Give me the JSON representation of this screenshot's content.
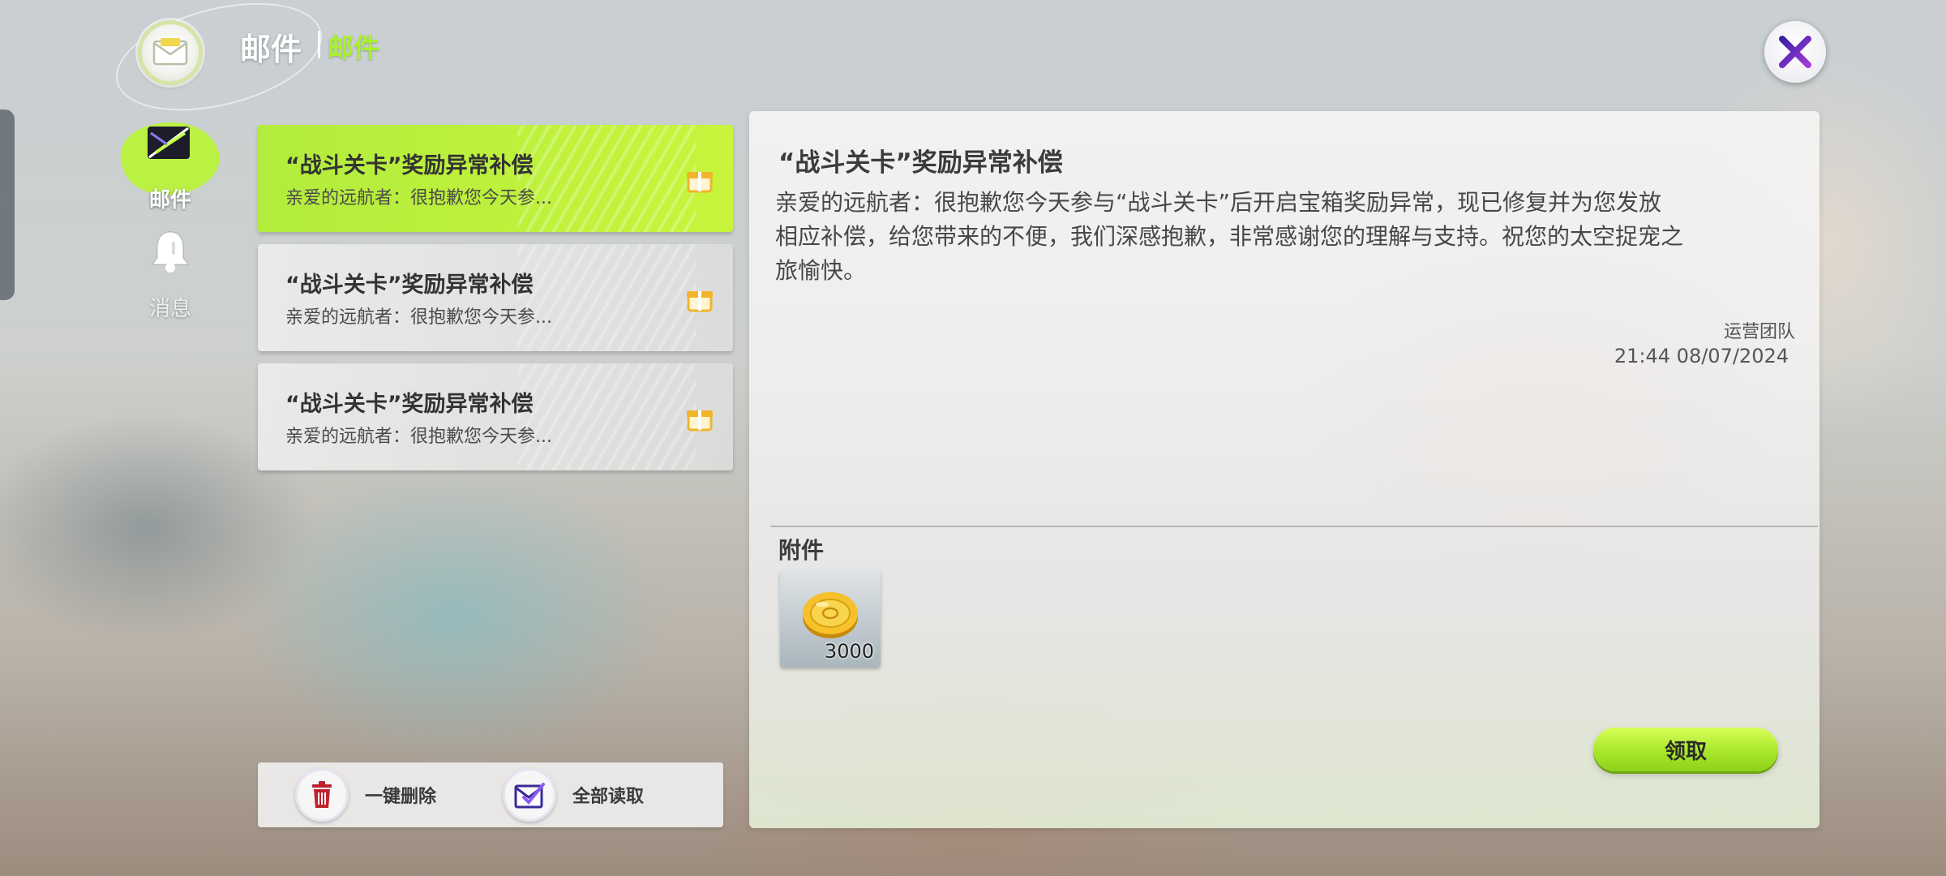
{
  "header": {
    "title": "邮件",
    "subtitle": "邮件",
    "icon": "mail-icon",
    "close_icon": "close-icon"
  },
  "nav": {
    "items": [
      {
        "label": "邮件",
        "icon": "mail-icon",
        "active": true
      },
      {
        "label": "消息",
        "icon": "bell-icon",
        "active": false
      }
    ]
  },
  "mail_list": [
    {
      "title": "“战斗关卡”奖励异常补偿",
      "preview": "亲爱的远航者：很抱歉您今天参...",
      "icon": "gift-icon",
      "selected": true
    },
    {
      "title": "“战斗关卡”奖励异常补偿",
      "preview": "亲爱的远航者：很抱歉您今天参...",
      "icon": "gift-icon",
      "selected": false
    },
    {
      "title": "“战斗关卡”奖励异常补偿",
      "preview": "亲爱的远航者：很抱歉您今天参...",
      "icon": "gift-icon",
      "selected": false
    }
  ],
  "actions": {
    "delete_all": {
      "label": "一键删除",
      "icon": "trash-icon"
    },
    "read_all": {
      "label": "全部读取",
      "icon": "read-all-icon"
    }
  },
  "detail": {
    "title": "“战斗关卡”奖励异常补偿",
    "body": "亲爱的远航者：很抱歉您今天参与“战斗关卡”后开启宝箱奖励异常，现已修复并为您发放相应补偿，给您带来的不便，我们深感抱歉，非常感谢您的理解与支持。祝您的太空捉宠之旅愉快。",
    "sender": "运营团队",
    "time": "21:44 08/07/2024",
    "attachments_label": "附件",
    "attachments": [
      {
        "icon": "gold-coin-icon",
        "quantity": "3000"
      }
    ],
    "claim_label": "领取"
  },
  "colors": {
    "accent": "#b3ec3d",
    "accent_text": "#a9f22a",
    "close_x": "#5b2bb0"
  }
}
